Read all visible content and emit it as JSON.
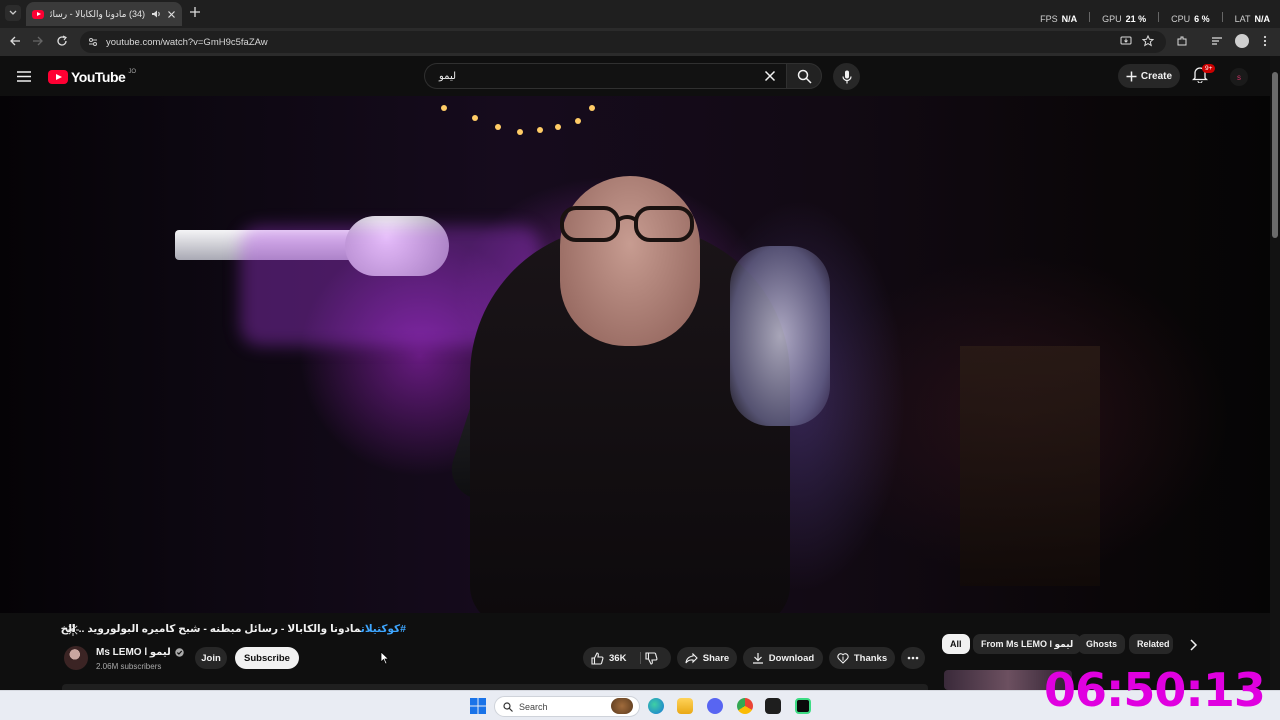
{
  "browser": {
    "tab_title": "(34) مادونا والكابالا - رسائل ...",
    "url": "youtube.com/watch?v=GmH9c5faZAw",
    "perf": [
      {
        "label": "FPS",
        "value": "N/A"
      },
      {
        "label": "GPU",
        "value": "21 %"
      },
      {
        "label": "CPU",
        "value": "6 %"
      },
      {
        "label": "LAT",
        "value": "N/A"
      }
    ]
  },
  "youtube": {
    "logo_text": "YouTube",
    "logo_country": "JO",
    "search_value": "ليمو",
    "create_label": "Create",
    "notif_badge": "9+",
    "avatar_letter": "s"
  },
  "video": {
    "title_hashtag": "#كوكتيلات",
    "title_text": "مادونا والكابالا - رسائل مبطنه - شبح كاميره البولورويد .. الخ",
    "channel_name": "Ms LEMO l ليمو",
    "subscribers": "2.06M subscribers",
    "join_label": "Join",
    "subscribe_label": "Subscribe",
    "likes": "36K",
    "share_label": "Share",
    "download_label": "Download",
    "thanks_label": "Thanks"
  },
  "chips": [
    "All",
    "From Ms LEMO l ليمو",
    "Ghosts",
    "Related"
  ],
  "overlay_clock": "06:50:13",
  "taskbar": {
    "search_placeholder": "Search"
  },
  "colors": {
    "yt_red": "#ff0033",
    "link_blue": "#3ea6ff",
    "clock_magenta": "#e000e0"
  }
}
